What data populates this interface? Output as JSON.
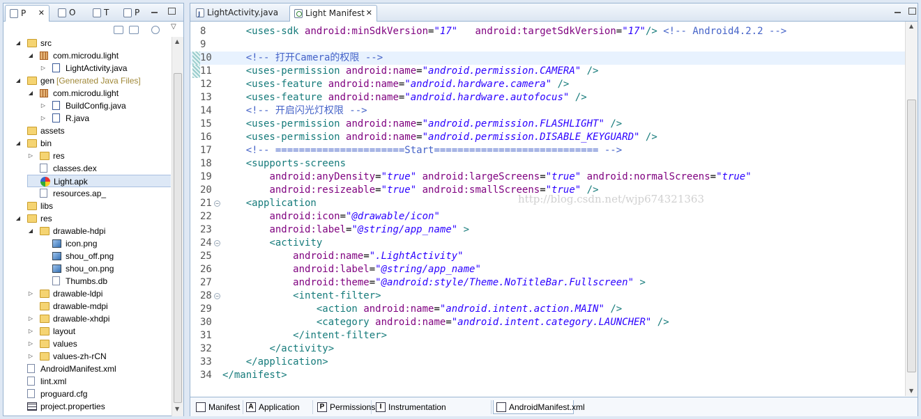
{
  "left_panel": {
    "tabs": [
      {
        "label": "P",
        "icon": "package-explorer-icon"
      },
      {
        "label": "O",
        "icon": "outline-icon"
      },
      {
        "label": "T",
        "icon": "type-hierarchy-icon"
      },
      {
        "label": "P",
        "icon": "project-explorer-icon"
      }
    ],
    "tree": [
      {
        "label": "src",
        "icon": "folder-icon"
      },
      {
        "label": "com.microdu.light",
        "icon": "package-icon"
      },
      {
        "label": "LightActivity.java",
        "icon": "java-file-icon"
      },
      {
        "label": "gen",
        "suffix": "[Generated Java Files]",
        "icon": "folder-icon"
      },
      {
        "label": "com.microdu.light",
        "icon": "package-icon"
      },
      {
        "label": "BuildConfig.java",
        "icon": "java-file-icon"
      },
      {
        "label": "R.java",
        "icon": "java-file-icon"
      },
      {
        "label": "assets",
        "icon": "folder-icon"
      },
      {
        "label": "bin",
        "icon": "folder-icon"
      },
      {
        "label": "res",
        "icon": "folder-icon"
      },
      {
        "label": "classes.dex",
        "icon": "file-icon"
      },
      {
        "label": "Light.apk",
        "icon": "apk-icon"
      },
      {
        "label": "resources.ap_",
        "icon": "file-icon"
      },
      {
        "label": "libs",
        "icon": "folder-icon"
      },
      {
        "label": "res",
        "icon": "folder-icon"
      },
      {
        "label": "drawable-hdpi",
        "icon": "folder-icon"
      },
      {
        "label": "icon.png",
        "icon": "image-icon"
      },
      {
        "label": "shou_off.png",
        "icon": "image-icon"
      },
      {
        "label": "shou_on.png",
        "icon": "image-icon"
      },
      {
        "label": "Thumbs.db",
        "icon": "file-icon"
      },
      {
        "label": "drawable-ldpi",
        "icon": "folder-icon"
      },
      {
        "label": "drawable-mdpi",
        "icon": "folder-icon"
      },
      {
        "label": "drawable-xhdpi",
        "icon": "folder-icon"
      },
      {
        "label": "layout",
        "icon": "folder-icon"
      },
      {
        "label": "values",
        "icon": "folder-icon"
      },
      {
        "label": "values-zh-rCN",
        "icon": "folder-icon"
      },
      {
        "label": "AndroidManifest.xml",
        "icon": "xml-file-icon"
      },
      {
        "label": "lint.xml",
        "icon": "xml-file-icon"
      },
      {
        "label": "proguard.cfg",
        "icon": "file-icon"
      },
      {
        "label": "project.properties",
        "icon": "properties-file-icon"
      }
    ]
  },
  "editor": {
    "tabs": [
      {
        "label": "LightActivity.java",
        "icon": "java-file-icon"
      },
      {
        "label": "Light Manifest",
        "icon": "xml-file-icon"
      }
    ],
    "lines": [
      {
        "n": "8",
        "t": "    <uses-sdk android:minSdkVersion=\"17\"   android:targetSdkVersion=\"17\"/> <!-- Android4.2.2 -->"
      },
      {
        "n": "9",
        "t": ""
      },
      {
        "n": "10",
        "t": "    <!-- 打开Camera的权限 -->"
      },
      {
        "n": "11",
        "t": "    <uses-permission android:name=\"android.permission.CAMERA\" />"
      },
      {
        "n": "12",
        "t": "    <uses-feature android:name=\"android.hardware.camera\" />"
      },
      {
        "n": "13",
        "t": "    <uses-feature android:name=\"android.hardware.autofocus\" />"
      },
      {
        "n": "14",
        "t": "    <!-- 开启闪光灯权限 -->"
      },
      {
        "n": "15",
        "t": "    <uses-permission android:name=\"android.permission.FLASHLIGHT\" />"
      },
      {
        "n": "16",
        "t": "    <uses-permission android:name=\"android.permission.DISABLE_KEYGUARD\" />"
      },
      {
        "n": "17",
        "t": "    <!-- ======================Start============================ -->"
      },
      {
        "n": "18",
        "t": "    <supports-screens"
      },
      {
        "n": "19",
        "t": "        android:anyDensity=\"true\" android:largeScreens=\"true\" android:normalScreens=\"true\""
      },
      {
        "n": "20",
        "t": "        android:resizeable=\"true\" android:smallScreens=\"true\" />"
      },
      {
        "n": "21",
        "t": "    <application"
      },
      {
        "n": "22",
        "t": "        android:icon=\"@drawable/icon\""
      },
      {
        "n": "23",
        "t": "        android:label=\"@string/app_name\" >"
      },
      {
        "n": "24",
        "t": "        <activity"
      },
      {
        "n": "25",
        "t": "            android:name=\".LightActivity\""
      },
      {
        "n": "26",
        "t": "            android:label=\"@string/app_name\""
      },
      {
        "n": "27",
        "t": "            android:theme=\"@android:style/Theme.NoTitleBar.Fullscreen\" >"
      },
      {
        "n": "28",
        "t": "            <intent-filter>"
      },
      {
        "n": "29",
        "t": "                <action android:name=\"android.intent.action.MAIN\" />"
      },
      {
        "n": "30",
        "t": "                <category android:name=\"android.intent.category.LAUNCHER\" />"
      },
      {
        "n": "31",
        "t": "            </intent-filter>"
      },
      {
        "n": "32",
        "t": "        </activity>"
      },
      {
        "n": "33",
        "t": "    </application>"
      },
      {
        "n": "34",
        "t": "</manifest>"
      }
    ],
    "watermark": "http://blog.csdn.net/wjp674321363",
    "bottom_tabs": [
      {
        "label": "Manifest",
        "glyph": ""
      },
      {
        "label": "Application",
        "glyph": "A"
      },
      {
        "label": "Permissions",
        "glyph": "P"
      },
      {
        "label": "Instrumentation",
        "glyph": "I"
      },
      {
        "label": "AndroidManifest.xml",
        "glyph": ""
      }
    ]
  },
  "colors": {
    "tag": "#167b7b",
    "attr": "#7f007f",
    "value": "#2a00ff",
    "comment": "#4563c8",
    "frame": "#99b4d1"
  }
}
